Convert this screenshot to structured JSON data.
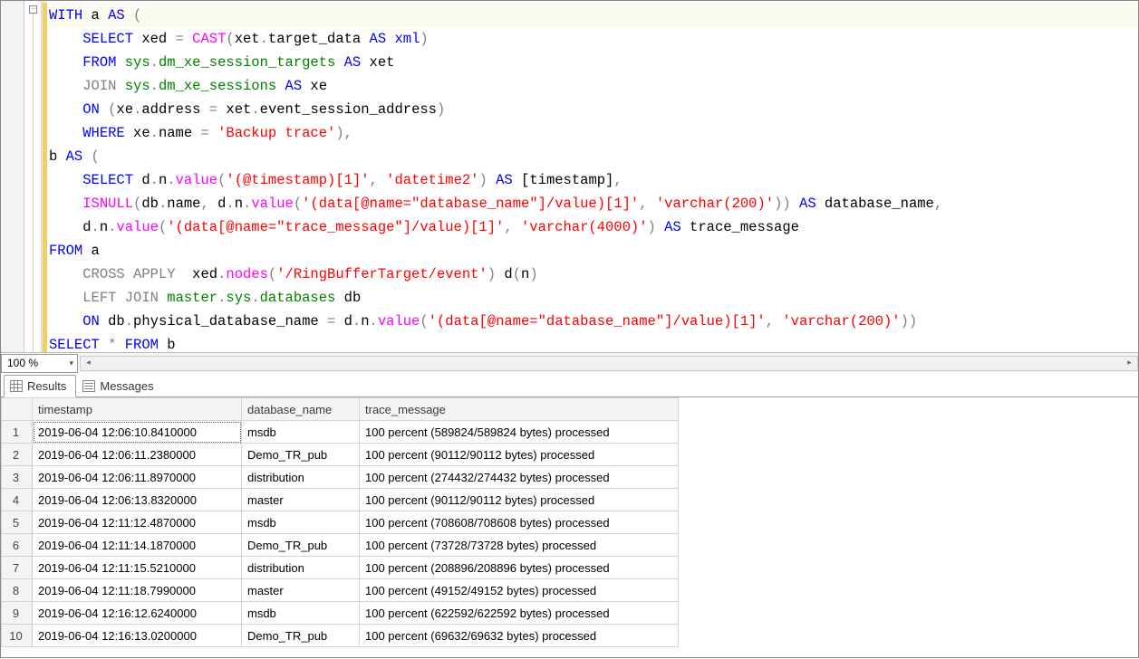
{
  "editor": {
    "zoom": "100 %",
    "fold_symbol": "−",
    "lines": [
      {
        "hl": true,
        "tokens": [
          [
            "kw",
            "WITH"
          ],
          [
            "plain",
            " a "
          ],
          [
            "kw",
            "AS"
          ],
          [
            "plain",
            " "
          ],
          [
            "op",
            "("
          ]
        ]
      },
      {
        "tokens": [
          [
            "plain",
            "    "
          ],
          [
            "kw",
            "SELECT"
          ],
          [
            "plain",
            " xed "
          ],
          [
            "op",
            "="
          ],
          [
            "plain",
            " "
          ],
          [
            "func",
            "CAST"
          ],
          [
            "op",
            "("
          ],
          [
            "plain",
            "xet"
          ],
          [
            "op",
            "."
          ],
          [
            "plain",
            "target_data "
          ],
          [
            "kw",
            "AS"
          ],
          [
            "plain",
            " "
          ],
          [
            "kw",
            "xml"
          ],
          [
            "op",
            ")"
          ]
        ]
      },
      {
        "tokens": [
          [
            "plain",
            "    "
          ],
          [
            "kw",
            "FROM"
          ],
          [
            "plain",
            " "
          ],
          [
            "obj",
            "sys"
          ],
          [
            "op",
            "."
          ],
          [
            "obj",
            "dm_xe_session_targets"
          ],
          [
            "plain",
            " "
          ],
          [
            "kw",
            "AS"
          ],
          [
            "plain",
            " xet"
          ]
        ]
      },
      {
        "tokens": [
          [
            "plain",
            "    "
          ],
          [
            "gray",
            "JOIN"
          ],
          [
            "plain",
            " "
          ],
          [
            "obj",
            "sys"
          ],
          [
            "op",
            "."
          ],
          [
            "obj",
            "dm_xe_sessions"
          ],
          [
            "plain",
            " "
          ],
          [
            "kw",
            "AS"
          ],
          [
            "plain",
            " xe"
          ]
        ]
      },
      {
        "tokens": [
          [
            "plain",
            "    "
          ],
          [
            "kw",
            "ON"
          ],
          [
            "plain",
            " "
          ],
          [
            "op",
            "("
          ],
          [
            "plain",
            "xe"
          ],
          [
            "op",
            "."
          ],
          [
            "plain",
            "address "
          ],
          [
            "op",
            "="
          ],
          [
            "plain",
            " xet"
          ],
          [
            "op",
            "."
          ],
          [
            "plain",
            "event_session_address"
          ],
          [
            "op",
            ")"
          ]
        ]
      },
      {
        "tokens": [
          [
            "plain",
            "    "
          ],
          [
            "kw",
            "WHERE"
          ],
          [
            "plain",
            " xe"
          ],
          [
            "op",
            "."
          ],
          [
            "plain",
            "name "
          ],
          [
            "op",
            "="
          ],
          [
            "plain",
            " "
          ],
          [
            "str",
            "'Backup trace'"
          ],
          [
            "op",
            ")"
          ],
          [
            "op",
            ","
          ]
        ]
      },
      {
        "tokens": [
          [
            "plain",
            "b "
          ],
          [
            "kw",
            "AS"
          ],
          [
            "plain",
            " "
          ],
          [
            "op",
            "("
          ]
        ]
      },
      {
        "tokens": [
          [
            "plain",
            "    "
          ],
          [
            "kw",
            "SELECT"
          ],
          [
            "plain",
            " d"
          ],
          [
            "op",
            "."
          ],
          [
            "plain",
            "n"
          ],
          [
            "op",
            "."
          ],
          [
            "func",
            "value"
          ],
          [
            "op",
            "("
          ],
          [
            "str",
            "'(@timestamp)[1]'"
          ],
          [
            "op",
            ","
          ],
          [
            "plain",
            " "
          ],
          [
            "str",
            "'datetime2'"
          ],
          [
            "op",
            ")"
          ],
          [
            "plain",
            " "
          ],
          [
            "kw",
            "AS"
          ],
          [
            "plain",
            " [timestamp]"
          ],
          [
            "op",
            ","
          ]
        ]
      },
      {
        "tokens": [
          [
            "plain",
            "    "
          ],
          [
            "func",
            "ISNULL"
          ],
          [
            "op",
            "("
          ],
          [
            "plain",
            "db"
          ],
          [
            "op",
            "."
          ],
          [
            "plain",
            "name"
          ],
          [
            "op",
            ","
          ],
          [
            "plain",
            " d"
          ],
          [
            "op",
            "."
          ],
          [
            "plain",
            "n"
          ],
          [
            "op",
            "."
          ],
          [
            "func",
            "value"
          ],
          [
            "op",
            "("
          ],
          [
            "str",
            "'(data[@name=\"database_name\"]/value)[1]'"
          ],
          [
            "op",
            ","
          ],
          [
            "plain",
            " "
          ],
          [
            "str",
            "'varchar(200)'"
          ],
          [
            "op",
            "))"
          ],
          [
            "plain",
            " "
          ],
          [
            "kw",
            "AS"
          ],
          [
            "plain",
            " database_name"
          ],
          [
            "op",
            ","
          ]
        ]
      },
      {
        "tokens": [
          [
            "plain",
            "    d"
          ],
          [
            "op",
            "."
          ],
          [
            "plain",
            "n"
          ],
          [
            "op",
            "."
          ],
          [
            "func",
            "value"
          ],
          [
            "op",
            "("
          ],
          [
            "str",
            "'(data[@name=\"trace_message\"]/value)[1]'"
          ],
          [
            "op",
            ","
          ],
          [
            "plain",
            " "
          ],
          [
            "str",
            "'varchar(4000)'"
          ],
          [
            "op",
            ")"
          ],
          [
            "plain",
            " "
          ],
          [
            "kw",
            "AS"
          ],
          [
            "plain",
            " trace_message"
          ]
        ]
      },
      {
        "tokens": [
          [
            "kw",
            "FROM"
          ],
          [
            "plain",
            " a"
          ]
        ]
      },
      {
        "tokens": [
          [
            "plain",
            "    "
          ],
          [
            "gray",
            "CROSS"
          ],
          [
            "plain",
            " "
          ],
          [
            "gray",
            "APPLY"
          ],
          [
            "plain",
            "  xed"
          ],
          [
            "op",
            "."
          ],
          [
            "func",
            "nodes"
          ],
          [
            "op",
            "("
          ],
          [
            "str",
            "'/RingBufferTarget/event'"
          ],
          [
            "op",
            ")"
          ],
          [
            "plain",
            " d"
          ],
          [
            "op",
            "("
          ],
          [
            "plain",
            "n"
          ],
          [
            "op",
            ")"
          ]
        ]
      },
      {
        "tokens": [
          [
            "plain",
            "    "
          ],
          [
            "gray",
            "LEFT"
          ],
          [
            "plain",
            " "
          ],
          [
            "gray",
            "JOIN"
          ],
          [
            "plain",
            " "
          ],
          [
            "obj",
            "master"
          ],
          [
            "op",
            "."
          ],
          [
            "obj",
            "sys"
          ],
          [
            "op",
            "."
          ],
          [
            "obj",
            "databases"
          ],
          [
            "plain",
            " db"
          ]
        ]
      },
      {
        "tokens": [
          [
            "plain",
            "    "
          ],
          [
            "kw",
            "ON"
          ],
          [
            "plain",
            " db"
          ],
          [
            "op",
            "."
          ],
          [
            "plain",
            "physical_database_name "
          ],
          [
            "op",
            "="
          ],
          [
            "plain",
            " d"
          ],
          [
            "op",
            "."
          ],
          [
            "plain",
            "n"
          ],
          [
            "op",
            "."
          ],
          [
            "func",
            "value"
          ],
          [
            "op",
            "("
          ],
          [
            "str",
            "'(data[@name=\"database_name\"]/value)[1]'"
          ],
          [
            "op",
            ","
          ],
          [
            "plain",
            " "
          ],
          [
            "str",
            "'varchar(200)'"
          ],
          [
            "op",
            "))"
          ]
        ]
      },
      {
        "tokens": [
          [
            "kw",
            "SELECT"
          ],
          [
            "plain",
            " "
          ],
          [
            "op",
            "*"
          ],
          [
            "plain",
            " "
          ],
          [
            "kw",
            "FROM"
          ],
          [
            "plain",
            " b"
          ]
        ]
      }
    ]
  },
  "result_tabs": {
    "results": "Results",
    "messages": "Messages"
  },
  "results": {
    "columns": [
      "timestamp",
      "database_name",
      "trace_message"
    ],
    "rows": [
      [
        "2019-06-04 12:06:10.8410000",
        "msdb",
        "100 percent (589824/589824 bytes) processed"
      ],
      [
        "2019-06-04 12:06:11.2380000",
        "Demo_TR_pub",
        "100 percent (90112/90112 bytes) processed"
      ],
      [
        "2019-06-04 12:06:11.8970000",
        "distribution",
        "100 percent (274432/274432 bytes) processed"
      ],
      [
        "2019-06-04 12:06:13.8320000",
        "master",
        "100 percent (90112/90112 bytes) processed"
      ],
      [
        "2019-06-04 12:11:12.4870000",
        "msdb",
        "100 percent (708608/708608 bytes) processed"
      ],
      [
        "2019-06-04 12:11:14.1870000",
        "Demo_TR_pub",
        "100 percent (73728/73728 bytes) processed"
      ],
      [
        "2019-06-04 12:11:15.5210000",
        "distribution",
        "100 percent (208896/208896 bytes) processed"
      ],
      [
        "2019-06-04 12:11:18.7990000",
        "master",
        "100 percent (49152/49152 bytes) processed"
      ],
      [
        "2019-06-04 12:16:12.6240000",
        "msdb",
        "100 percent (622592/622592 bytes) processed"
      ],
      [
        "2019-06-04 12:16:13.0200000",
        "Demo_TR_pub",
        "100 percent (69632/69632 bytes) processed"
      ]
    ]
  }
}
